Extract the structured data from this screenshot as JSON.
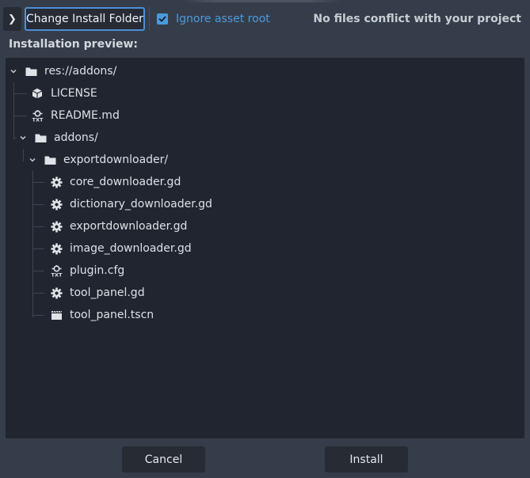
{
  "toolbar": {
    "expand_glyph": "❯",
    "change_folder_label": "Change Install Folder",
    "ignore_asset_root_label": "Ignore asset root",
    "ignore_asset_root_checked": true,
    "conflict_message": "No files conflict with your project"
  },
  "preview": {
    "heading": "Installation preview:"
  },
  "tree": [
    {
      "label": "res://addons/",
      "icon": "folder-icon",
      "expandable": true
    },
    {
      "label": "LICENSE",
      "icon": "file-box-icon",
      "expandable": false
    },
    {
      "label": "README.md",
      "icon": "text-file-icon",
      "expandable": false
    },
    {
      "label": "addons/",
      "icon": "folder-icon",
      "expandable": true
    },
    {
      "label": "exportdownloader/",
      "icon": "folder-icon",
      "expandable": true
    },
    {
      "label": "core_downloader.gd",
      "icon": "gear-icon",
      "expandable": false
    },
    {
      "label": "dictionary_downloader.gd",
      "icon": "gear-icon",
      "expandable": false
    },
    {
      "label": "exportdownloader.gd",
      "icon": "gear-icon",
      "expandable": false
    },
    {
      "label": "image_downloader.gd",
      "icon": "gear-icon",
      "expandable": false
    },
    {
      "label": "plugin.cfg",
      "icon": "text-file-icon",
      "expandable": false
    },
    {
      "label": "tool_panel.gd",
      "icon": "gear-icon",
      "expandable": false
    },
    {
      "label": "tool_panel.tscn",
      "icon": "clapperboard-icon",
      "expandable": false
    }
  ],
  "buttons": {
    "cancel_label": "Cancel",
    "install_label": "Install"
  },
  "colors": {
    "accent": "#4a9bdc",
    "panel_bg": "#202530",
    "dialog_bg": "#363d4a"
  }
}
